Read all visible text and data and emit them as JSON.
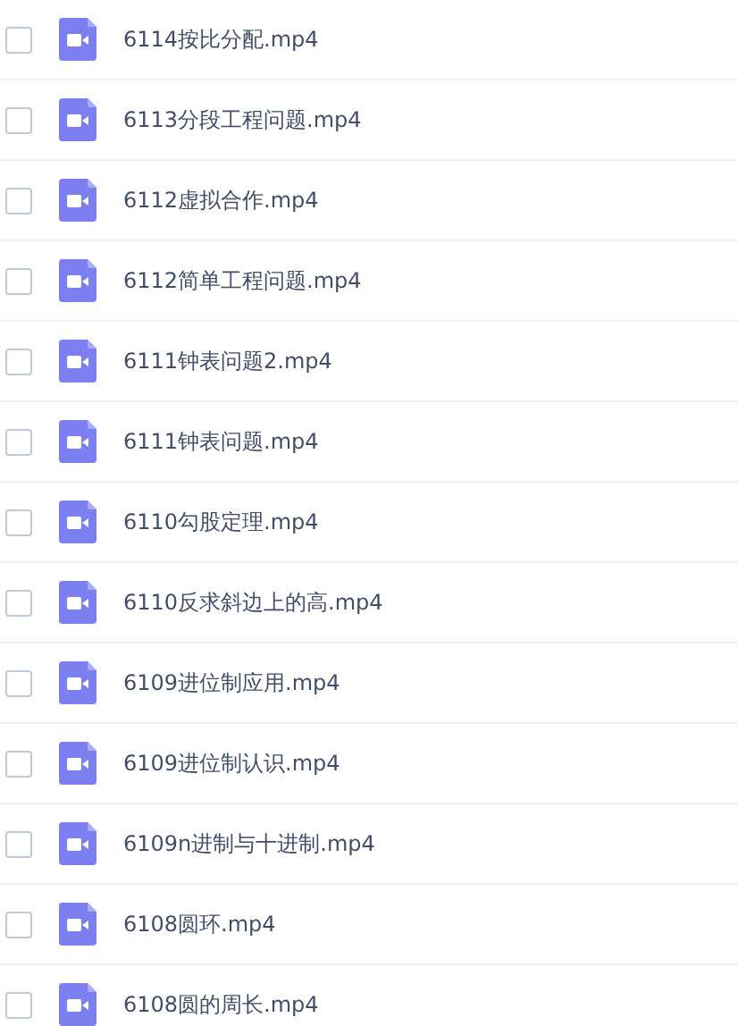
{
  "files": [
    {
      "name": "6114按比分配.mp4",
      "checked": false
    },
    {
      "name": "6113分段工程问题.mp4",
      "checked": false
    },
    {
      "name": "6112虚拟合作.mp4",
      "checked": false
    },
    {
      "name": "6112简单工程问题.mp4",
      "checked": false
    },
    {
      "name": "6111钟表问题2.mp4",
      "checked": false
    },
    {
      "name": "6111钟表问题.mp4",
      "checked": false
    },
    {
      "name": "6110勾股定理.mp4",
      "checked": false
    },
    {
      "name": "6110反求斜边上的高.mp4",
      "checked": false
    },
    {
      "name": "6109进位制应用.mp4",
      "checked": false
    },
    {
      "name": "6109进位制认识.mp4",
      "checked": false
    },
    {
      "name": "6109n进制与十进制.mp4",
      "checked": false
    },
    {
      "name": "6108圆环.mp4",
      "checked": false
    },
    {
      "name": "6108圆的周长.mp4",
      "checked": false
    }
  ]
}
